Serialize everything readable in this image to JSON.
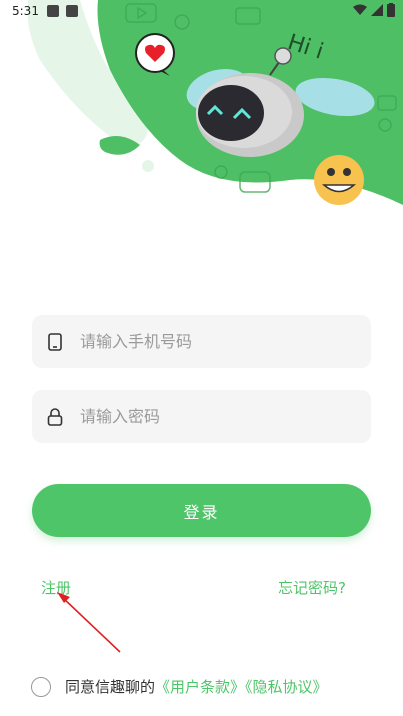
{
  "status_bar": {
    "time": "5:31"
  },
  "hero": {
    "speech_text": "Hi i"
  },
  "form": {
    "phone_placeholder": "请输入手机号码",
    "password_placeholder": "请输入密码",
    "login_label": "登录"
  },
  "links": {
    "register": "注册",
    "forgot_password": "忘记密码?"
  },
  "agreement": {
    "prefix": "同意信趣聊的",
    "terms": "《用户条款》",
    "privacy": "《隐私协议》"
  },
  "colors": {
    "brand_green": "#4fc56a",
    "field_bg": "#f5f5f5",
    "annotation_red": "#e02020"
  }
}
